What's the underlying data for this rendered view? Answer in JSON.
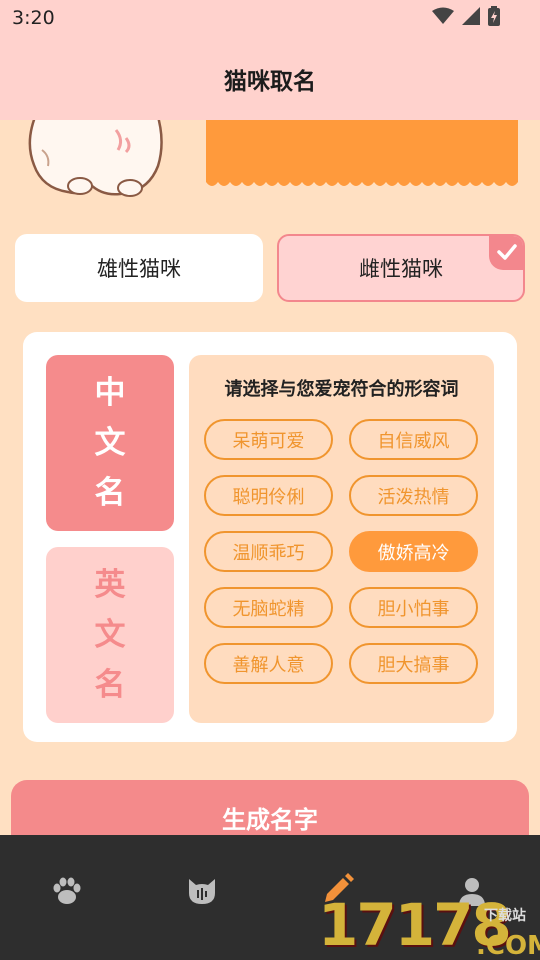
{
  "status": {
    "time": "3:20"
  },
  "app": {
    "title": "猫咪取名"
  },
  "gender": {
    "male": "雄性猫咪",
    "female": "雌性猫咪",
    "selected": "female"
  },
  "lang_tabs": {
    "cn": [
      "中",
      "文",
      "名"
    ],
    "en": [
      "英",
      "文",
      "名"
    ],
    "selected": "cn"
  },
  "adjectives": {
    "title": "请选择与您爱宠符合的形容词",
    "items": [
      {
        "label": "呆萌可爱",
        "selected": false
      },
      {
        "label": "自信威风",
        "selected": false
      },
      {
        "label": "聪明伶俐",
        "selected": false
      },
      {
        "label": "活泼热情",
        "selected": false
      },
      {
        "label": "温顺乖巧",
        "selected": false
      },
      {
        "label": "傲娇高冷",
        "selected": true
      },
      {
        "label": "无脑蛇精",
        "selected": false
      },
      {
        "label": "胆小怕事",
        "selected": false
      },
      {
        "label": "善解人意",
        "selected": false
      },
      {
        "label": "胆大搞事",
        "selected": false
      }
    ]
  },
  "generate_button": "生成名字",
  "nav": {
    "items": [
      "paw-icon",
      "cat-face-icon",
      "pencil-icon",
      "user-icon"
    ],
    "active": 2
  },
  "watermark": {
    "number": "17178",
    "domain": ".COM",
    "sub": "下载站"
  },
  "colors": {
    "accent_pink": "#f48a8b",
    "accent_orange": "#ff9a3c",
    "bg": "#ffe0c2"
  }
}
